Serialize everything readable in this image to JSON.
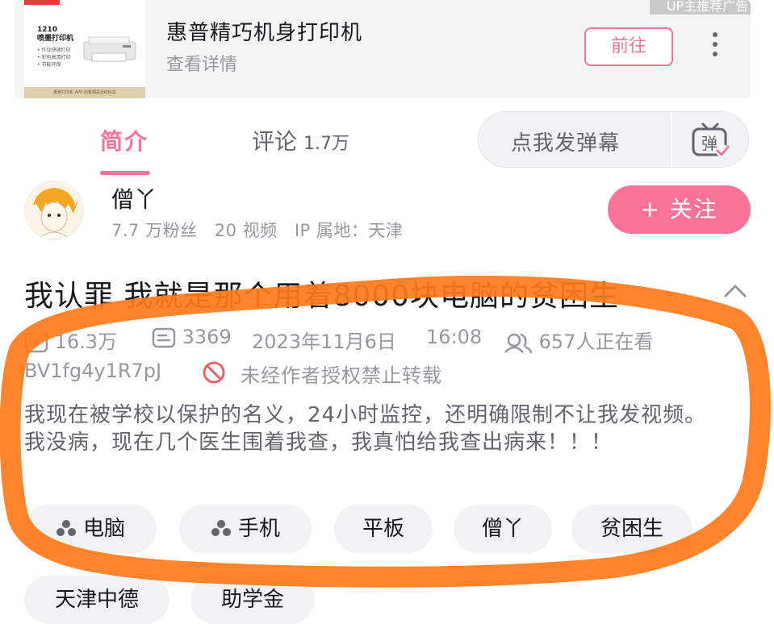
{
  "ad": {
    "title": "惠普精巧机身打印机",
    "subtitle": "查看详情",
    "go_label": "前往",
    "tag_label": "UP主推荐广告",
    "thumb_model": "1210",
    "thumb_type": "喷墨打印机",
    "thumb_features": [
      "• 作业快速打印",
      "• 彩色高清打印",
      "• 节能环保"
    ],
    "thumb_footer": "惠普打印机 APP 内有相关活动信息"
  },
  "tabs": {
    "intro_label": "简介",
    "comments_label": "评论",
    "comments_count": "1.7万"
  },
  "danmaku": {
    "placeholder": "点我发弹幕",
    "button_glyph": "弹"
  },
  "uploader": {
    "name": "僧丫",
    "fans": "7.7 万粉丝",
    "videos": "20 视频",
    "ip": "IP 属地：天津",
    "follow_label": "+ 关注"
  },
  "video": {
    "title": "我认罪 我就是那个用着8000块电脑的贫困生",
    "views": "16.3万",
    "danmaku_count": "3369",
    "date": "2023年11月6日",
    "time": "16:08",
    "watching": "657人正在看",
    "bvid": "BV1fg4y1R7pJ",
    "no_repost": "未经作者授权禁止转载",
    "description_lines": [
      "我现在被学校以保护的名义，24小时监控，还明确限制不让我发视频。",
      "我没病，现在几个医生围着我查，我真怕给我查出病来！！！"
    ]
  },
  "tags": [
    "电脑",
    "手机",
    "平板",
    "僧丫",
    "贫困生",
    "天津中德",
    "助学金"
  ],
  "colors": {
    "accent": "#fb7299",
    "annotation": "#ff7a1a",
    "muted_text": "#9499a0"
  }
}
